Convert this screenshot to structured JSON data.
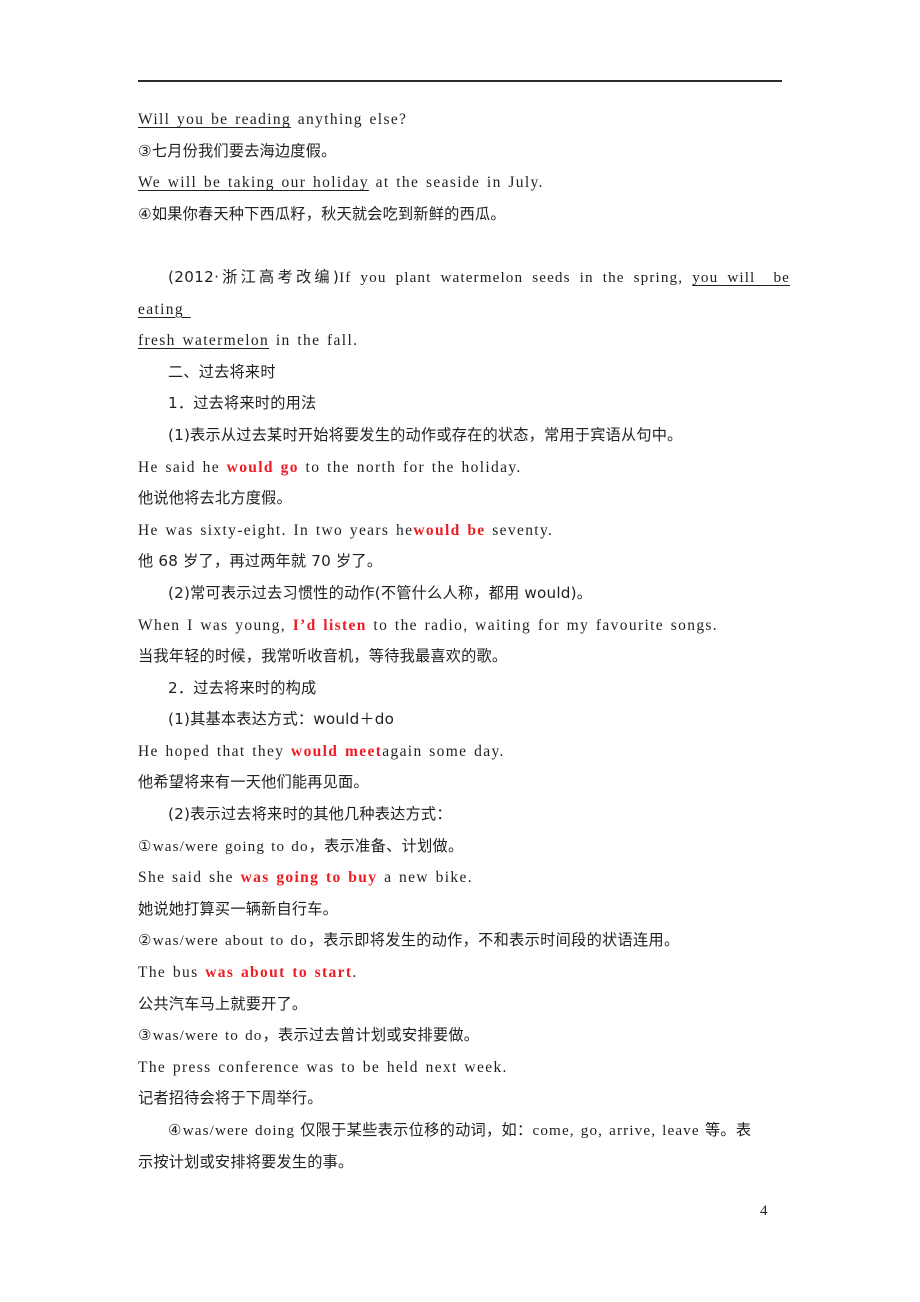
{
  "page": {
    "number": "4",
    "accent_red": "#ed1c24",
    "text_color": "#231f20",
    "rule_color": "#2b2b2b",
    "background": "#ffffff"
  },
  "lines": {
    "l01_en_a": "Will you be reading",
    "l01_en_b": " anything else?",
    "l02_cn": "③七月份我们要去海边度假。",
    "l03_en_a": "We will be taking our holiday",
    "l03_en_b": " at the seaside in July.",
    "l04_cn": "④如果你春天种下西瓜籽，秋天就会吃到新鲜的西瓜。",
    "l05_cite_cn": "(2012·浙江高考改编)",
    "l05_cite_en": "If you plant watermelon seeds in the spring, ",
    "l05_cite_ul": "you will  be",
    "l06_ul": "eating ",
    "l07_ul": "fresh watermelon",
    "l07_rest": " in the fall.",
    "l08_heading": "二、过去将来时",
    "l09_heading": "1．过去将来时的用法",
    "l10_cn": "(1)表示从过去某时开始将要发生的动作或存在的状态，常用于宾语从句中。",
    "l11_en_a": "He said he ",
    "l11_en_red": "would go",
    "l11_en_b": " to the north for the holiday.",
    "l12_cn": "他说他将去北方度假。",
    "l13_en_a": "He was sixty-eight. In two years he",
    "l13_en_red": "would be",
    "l13_en_b": " seventy.",
    "l14_cn": "他 68 岁了，再过两年就 70 岁了。",
    "l15_cn": "(2)常可表示过去习惯性的动作(不管什么人称，都用 would)。",
    "l16_en_a": "When I was young, ",
    "l16_en_red": "I’d listen",
    "l16_en_b": " to the radio, waiting for my favourite songs.",
    "l17_cn": "当我年轻的时候，我常听收音机，等待我最喜欢的歌。",
    "l18_heading": "2．过去将来时的构成",
    "l19_cn": "(1)其基本表达方式：would＋do",
    "l20_en_a": "He hoped that they ",
    "l20_en_red": "would meet",
    "l20_en_b": "again some day.",
    "l21_cn": "他希望将来有一天他们能再见面。",
    "l22_cn": "(2)表示过去将来时的其他几种表达方式：",
    "l23_mix_lat": "①was/were going to do",
    "l23_mix_cn": "，表示准备、计划做。",
    "l24_en_a": "She said she ",
    "l24_en_red": "was going to buy",
    "l24_en_b": " a new bike.",
    "l25_cn": "她说她打算买一辆新自行车。",
    "l26_mix_lat": "②was/were about to do",
    "l26_mix_cn": "，表示即将发生的动作，不和表示时间段的状语连用。",
    "l27_en_a": "The bus ",
    "l27_en_red": "was about to start",
    "l27_en_b": ".",
    "l28_cn": "公共汽车马上就要开了。",
    "l29_mix_lat": "③was/were to do",
    "l29_mix_cn": "，表示过去曾计划或安排要做。",
    "l30_en": "The press conference was to be held next week.",
    "l31_cn": "记者招待会将于下周举行。",
    "l32_p1_lat": "④was/were doing",
    "l32_p1_cn": " 仅限于某些表示位移的动词，如：",
    "l32_p2_lat": "come, go, arrive, leave",
    "l32_p3_cn": " 等。表",
    "l33_cn": "示按计划或安排将要发生的事。"
  }
}
